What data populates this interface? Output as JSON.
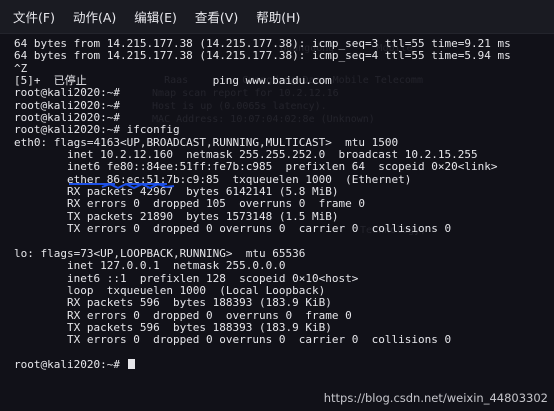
{
  "menu": [
    "文件(F)",
    "动作(A)",
    "编辑(E)",
    "查看(V)",
    "帮助(H)"
  ],
  "terminal": {
    "lines": [
      "64 bytes from 14.215.177.38 (14.215.177.38): icmp_seq=3 ttl=55 time=9.21 ms",
      "64 bytes from 14.215.177.38 (14.215.177.38): icmp_seq=4 ttl=55 time=5.94 ms",
      "^Z",
      "[5]+  已停止                   ping www.baidu.com",
      "root@kali2020:~#",
      "root@kali2020:~#",
      "root@kali2020:~#",
      "root@kali2020:~# ifconfig",
      "eth0: flags=4163<UP,BROADCAST,RUNNING,MULTICAST>  mtu 1500",
      "        inet 10.2.12.160  netmask 255.255.252.0  broadcast 10.2.15.255",
      "        inet6 fe80::84ee:51ff:fe7b:c985  prefixlen 64  scopeid 0×20<link>",
      "        ether 86:ec:51:7b:c9:85  txqueuelen 1000  (Ethernet)",
      "        RX packets 42967  bytes 6142141 (5.8 MiB)",
      "        RX errors 0  dropped 105  overruns 0  frame 0",
      "        TX packets 21890  bytes 1573148 (1.5 MiB)",
      "        TX errors 0  dropped 0 overruns 0  carrier 0  collisions 0",
      "",
      "lo: flags=73<UP,LOOPBACK,RUNNING>  mtu 65536",
      "        inet 127.0.0.1  netmask 255.0.0.0",
      "        inet6 ::1  prefixlen 128  scopeid 0×10<host>",
      "        loop  txqueuelen 1000  (Local Loopback)",
      "        RX packets 596  bytes 188393 (183.9 KiB)",
      "        RX errors 0  dropped 0  overruns 0  frame 0",
      "        TX packets 596  bytes 188393 (183.9 KiB)",
      "        TX errors 0  dropped 0 overruns 0  carrier 0  collisions 0",
      "",
      "root@kali2020:~# "
    ]
  },
  "watermark": "https://blog.csdn.net/weixin_44803302",
  "colors": {
    "background": "#111118",
    "text": "#e6e6ea",
    "annotation": "#1c4fe6"
  }
}
